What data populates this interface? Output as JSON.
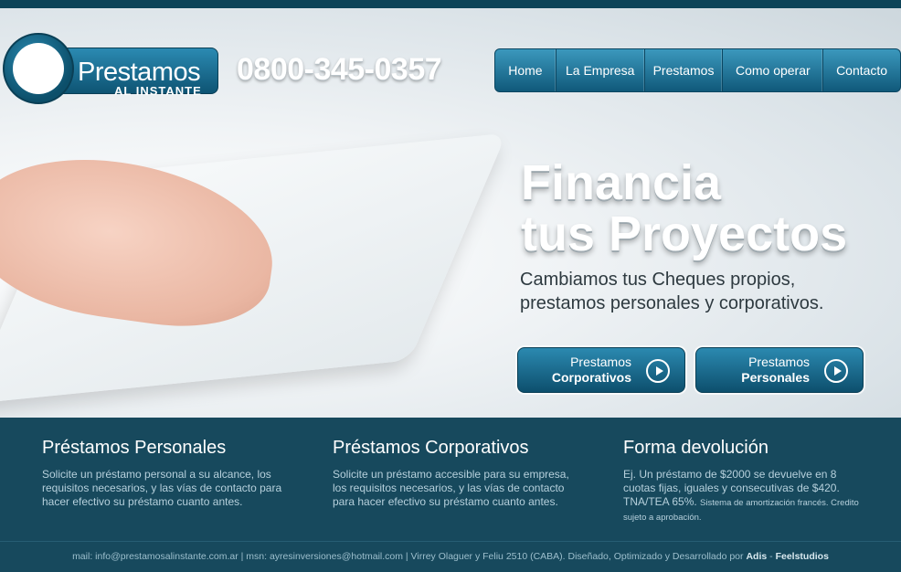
{
  "logo": {
    "title": "Prestamos",
    "subtitle": "AL INSTANTE"
  },
  "phone": "0800-345-0357",
  "nav": [
    {
      "label": "Home"
    },
    {
      "label": "La Empresa"
    },
    {
      "label": "Prestamos"
    },
    {
      "label": "Como operar"
    },
    {
      "label": "Contacto"
    }
  ],
  "hero": {
    "headline_1": "Financia",
    "headline_2": "tus Proyectos",
    "sub_1": "Cambiamos tus Cheques propios,",
    "sub_2": "prestamos personales y corporativos.",
    "cta_corporativos": {
      "line1": "Prestamos",
      "line2": "Corporativos",
      "icon": "play-circle-icon"
    },
    "cta_personales": {
      "line1": "Prestamos",
      "line2": "Personales",
      "icon": "play-circle-icon"
    }
  },
  "sections": [
    {
      "title": "Préstamos Personales",
      "text": "Solicite un préstamo personal a su alcance, los requisitos necesarios, y las vías de contacto para hacer efectivo su préstamo cuanto antes."
    },
    {
      "title": "Préstamos Corporativos",
      "text": "Solicite un préstamo accesible para su empresa, los requisitos necesarios, y las vías de contacto para hacer efectivo su préstamo cuanto antes."
    },
    {
      "title": "Forma devolución",
      "text": "Ej. Un préstamo de $2000 se devuelve en 8 cuotas fijas, iguales y consecutivas de $420. TNA/TEA 65%.",
      "note": "Sistema de amortización francés. Credito sujeto a aprobación."
    }
  ],
  "footer": {
    "text": "mail: info@prestamosalinstante.com.ar | msn: ayresinversiones@hotmail.com | Virrey Olaguer y Feliu 2510 (CABA). Diseñado, Optimizado y Desarrollado por",
    "brand1": "Adis",
    "sep": " - ",
    "brand2": "Feelstudios"
  },
  "colors": {
    "accent": "#17495d",
    "button": "#1a6f95"
  }
}
